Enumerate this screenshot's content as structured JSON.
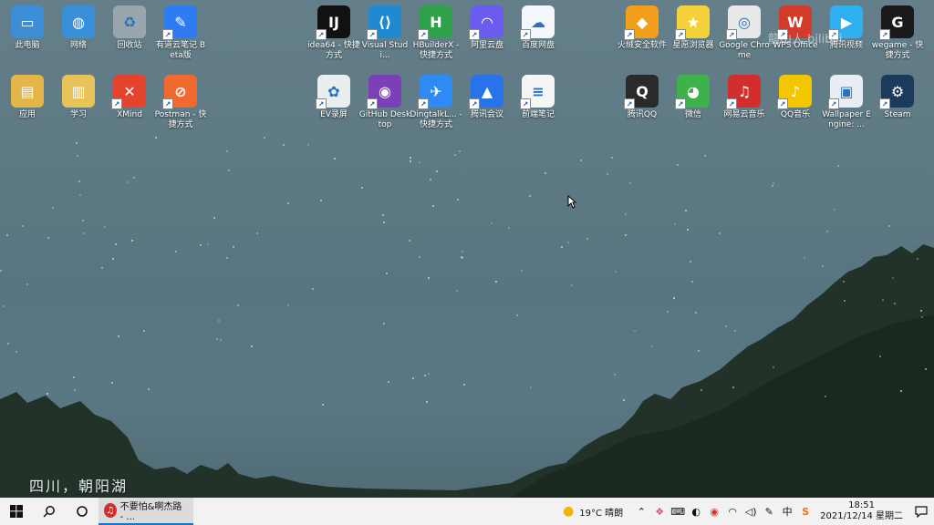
{
  "desktop": {
    "caption": "四川，朝阳湖",
    "watermark": "龍山人 bilibili"
  },
  "icons": [
    {
      "label": "此电脑",
      "name": "this-pc-icon",
      "color": "#3c8fd6",
      "glyph": "▭"
    },
    {
      "label": "网络",
      "name": "network-icon",
      "color": "#3a8fd9",
      "glyph": "◍"
    },
    {
      "label": "回收站",
      "name": "recycle-bin-icon",
      "color": "#9aa6ad",
      "glyph": "♻"
    },
    {
      "label": "有道云笔记 Beta版",
      "name": "youdao-note-icon",
      "color": "#2f7bf3",
      "glyph": "✎"
    },
    {
      "label": "应用",
      "name": "apps-folder-icon",
      "color": "#e4b64a",
      "glyph": "▤"
    },
    {
      "label": "学习",
      "name": "study-folder-icon",
      "color": "#e8c35a",
      "glyph": "▥"
    },
    {
      "label": "XMind",
      "name": "xmind-icon",
      "color": "#e5432d",
      "glyph": "✕"
    },
    {
      "label": "Postman - 快捷方式",
      "name": "postman-icon",
      "color": "#f06a2f",
      "glyph": "⊘"
    },
    {
      "label": "idea64 - 快捷方式",
      "name": "idea-icon",
      "color": "#111111",
      "glyph": "IJ"
    },
    {
      "label": "Visual Studi...",
      "name": "vscode-icon",
      "color": "#1f8ad2",
      "glyph": "⟨⟩"
    },
    {
      "label": "HBuilderX - 快捷方式",
      "name": "hbuilderx-icon",
      "color": "#2ea14a",
      "glyph": "H"
    },
    {
      "label": "阿里云盘",
      "name": "aliyun-drive-icon",
      "color": "#6b5cf0",
      "glyph": "◠"
    },
    {
      "label": "百度网盘",
      "name": "baidu-netdisk-icon",
      "color": "#f4f7fb",
      "glyph": "☁"
    },
    {
      "label": "EV录屏",
      "name": "ev-recorder-icon",
      "color": "#e9eef1",
      "glyph": "✿"
    },
    {
      "label": "GitHub Desktop",
      "name": "github-desktop-icon",
      "color": "#7b3fb8",
      "glyph": "◉"
    },
    {
      "label": "DingtalkL... - 快捷方式",
      "name": "dingtalk-icon",
      "color": "#2f8bf4",
      "glyph": "✈"
    },
    {
      "label": "腾讯会议",
      "name": "tencent-meeting-icon",
      "color": "#2673ea",
      "glyph": "▲"
    },
    {
      "label": "前端笔记",
      "name": "frontend-notes-icon",
      "color": "#f5f5f5",
      "glyph": "≡"
    },
    {
      "label": "火绒安全软件",
      "name": "huorong-icon",
      "color": "#f2a01c",
      "glyph": "◆"
    },
    {
      "label": "星愿浏览器",
      "name": "twinkstar-browser-icon",
      "color": "#f4d33a",
      "glyph": "★"
    },
    {
      "label": "Google Chrome",
      "name": "chrome-icon",
      "color": "#e8e8e8",
      "glyph": "◎"
    },
    {
      "label": "WPS Office",
      "name": "wps-office-icon",
      "color": "#d23a2c",
      "glyph": "W"
    },
    {
      "label": "腾讯视频",
      "name": "tencent-video-icon",
      "color": "#2fb0f0",
      "glyph": "▶"
    },
    {
      "label": "wegame - 快捷方式",
      "name": "wegame-icon",
      "color": "#1a1a1a",
      "glyph": "G"
    },
    {
      "label": "腾讯QQ",
      "name": "qq-icon",
      "color": "#2a2a2a",
      "glyph": "Q"
    },
    {
      "label": "微信",
      "name": "wechat-icon",
      "color": "#3db24a",
      "glyph": "◕"
    },
    {
      "label": "网易云音乐",
      "name": "netease-music-icon",
      "color": "#d22e2e",
      "glyph": "♫"
    },
    {
      "label": "QQ音乐",
      "name": "qq-music-icon",
      "color": "#f3c600",
      "glyph": "♪"
    },
    {
      "label": "Wallpaper Engine: ...",
      "name": "wallpaper-engine-icon",
      "color": "#e8eef3",
      "glyph": "▣"
    },
    {
      "label": "Steam",
      "name": "steam-icon",
      "color": "#1c3b5c",
      "glyph": "⚙"
    }
  ],
  "taskbar": {
    "active_app_label": "不要怕&啊杰路 - ...",
    "weather": "19°C 晴朗",
    "ime_label": "中",
    "time": "18:51",
    "date": "2021/12/14 星期二"
  }
}
